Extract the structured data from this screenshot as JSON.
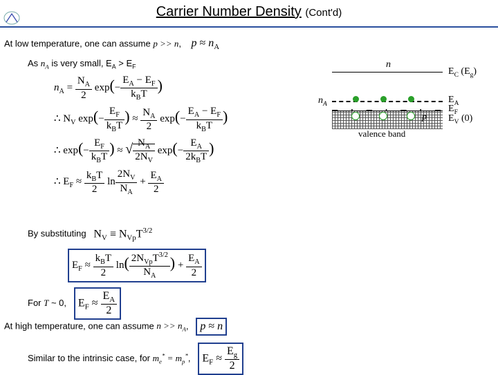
{
  "header": {
    "title_main": "Carrier Number Density",
    "title_cont": "(Cont'd)"
  },
  "t": {
    "line1a": "At low temperature, one can assume ",
    "line1b": "p >> n",
    "eq1": "p ≈ nA",
    "line2a": "As ",
    "line2b": "nA",
    "line2c": " is very small, E",
    "line2d": "A",
    "line2e": " > E",
    "line2f": "F",
    "bysub": "By substituting",
    "for_t0": "For T ~ 0,",
    "high_a": "At high temperature, one can assume ",
    "high_b": "n >> nA",
    "eq_pn": "p ≈ n",
    "sim_a": "Similar to the intrinsic case, for ",
    "sim_b": "me* = mp*"
  },
  "diag": {
    "n": "n",
    "nA": "nA",
    "p": "p",
    "vb": "valence band",
    "ec": "E",
    "ecsub": "C",
    "eg": " (E",
    "egsub": "g",
    "eg2": ")",
    "ea": "E",
    "easub": "A",
    "ef": "E",
    "efsub": "F",
    "ev": "E",
    "evsub": "V",
    "ev0": " (0)"
  },
  "eq": {
    "r1a": "nA =",
    "r1_num": "NA",
    "r1_den": "2",
    "r1b": " exp",
    "r1c": "− ",
    "r1c_num": "EA − EF",
    "r1c_den": "kBT",
    "r2a": "∴ NV exp",
    "r2_num1": "EF",
    "r2_den1": "kBT",
    "r2b": " ≈ ",
    "r2_num2": "NA",
    "r2_den2": "2",
    "r2c": " exp",
    "r2_num3": "EA − EF",
    "r2_den3": "kBT",
    "r3a": "∴ exp",
    "r3_num1": "EF",
    "r3_den1": "kBT",
    "r3b": " ≈ ",
    "r3_rt": "√",
    "r3_num2": "NA",
    "r3_den2": "2NV",
    "r3c": " exp",
    "r3_num3": "EA",
    "r3_den3": "2kBT",
    "r4a": "∴ EF ≈ ",
    "r4_num1": "kBT",
    "r4_den1": "2",
    "r4b": " ln",
    "r4_num2": "2NV",
    "r4_den2": "NA",
    "r4c": " + ",
    "r4_num3": "EA",
    "r4_den3": "2",
    "r5a": "NV ≡ NVpT3/2",
    "r6a": "EF ≈ ",
    "r6_num1": "kBT",
    "r6_den1": "2",
    "r6b": " ln",
    "r6_num2": "2NVpT3/2",
    "r6_den2": "NA",
    "r6c": " + ",
    "r6_num3": "EA",
    "r6_den3": "2",
    "r7a": "EF ≈ ",
    "r7_num": "EA",
    "r7_den": "2",
    "r8a": "EF ≈ ",
    "r8_num": "Eg",
    "r8_den": "2"
  }
}
